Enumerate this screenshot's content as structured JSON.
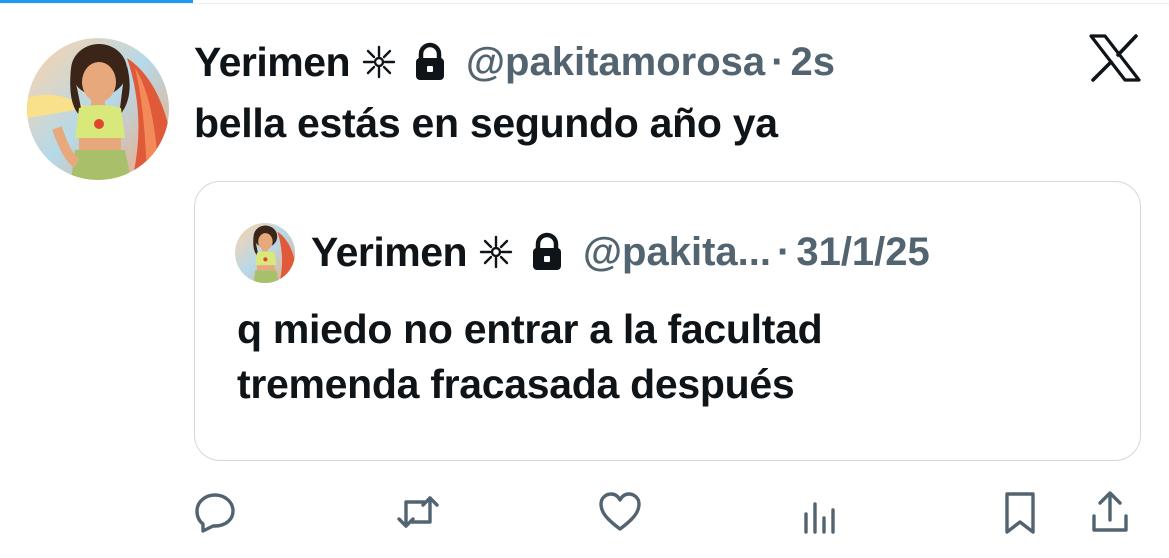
{
  "tweet": {
    "author_name": "Yerimen",
    "handle": "@pakitamorosa",
    "separator": "·",
    "time": "2s",
    "text": "bella estás en segundo año ya",
    "avatar_icon": "cartoon-girl-avatar",
    "badge_icon": "sparkle-icon",
    "protected_icon": "lock-icon",
    "platform_icon": "x-logo-icon"
  },
  "quoted_tweet": {
    "author_name": "Yerimen",
    "handle": "@pakita...",
    "separator": "·",
    "time": "31/1/25",
    "text_lines": [
      "q miedo no entrar a la facultad",
      "tremenda fracasada después"
    ]
  },
  "actions": [
    {
      "name": "reply",
      "icon": "reply-icon"
    },
    {
      "name": "repost",
      "icon": "repost-icon"
    },
    {
      "name": "like",
      "icon": "heart-icon"
    },
    {
      "name": "views",
      "icon": "views-icon"
    },
    {
      "name": "bookmark",
      "icon": "bookmark-icon"
    },
    {
      "name": "share",
      "icon": "share-icon"
    }
  ],
  "colors": {
    "text_primary": "#0f1419",
    "text_secondary": "#536471",
    "border": "#cfd9de",
    "accent": "#1d9bf0",
    "icon": "#536471"
  }
}
